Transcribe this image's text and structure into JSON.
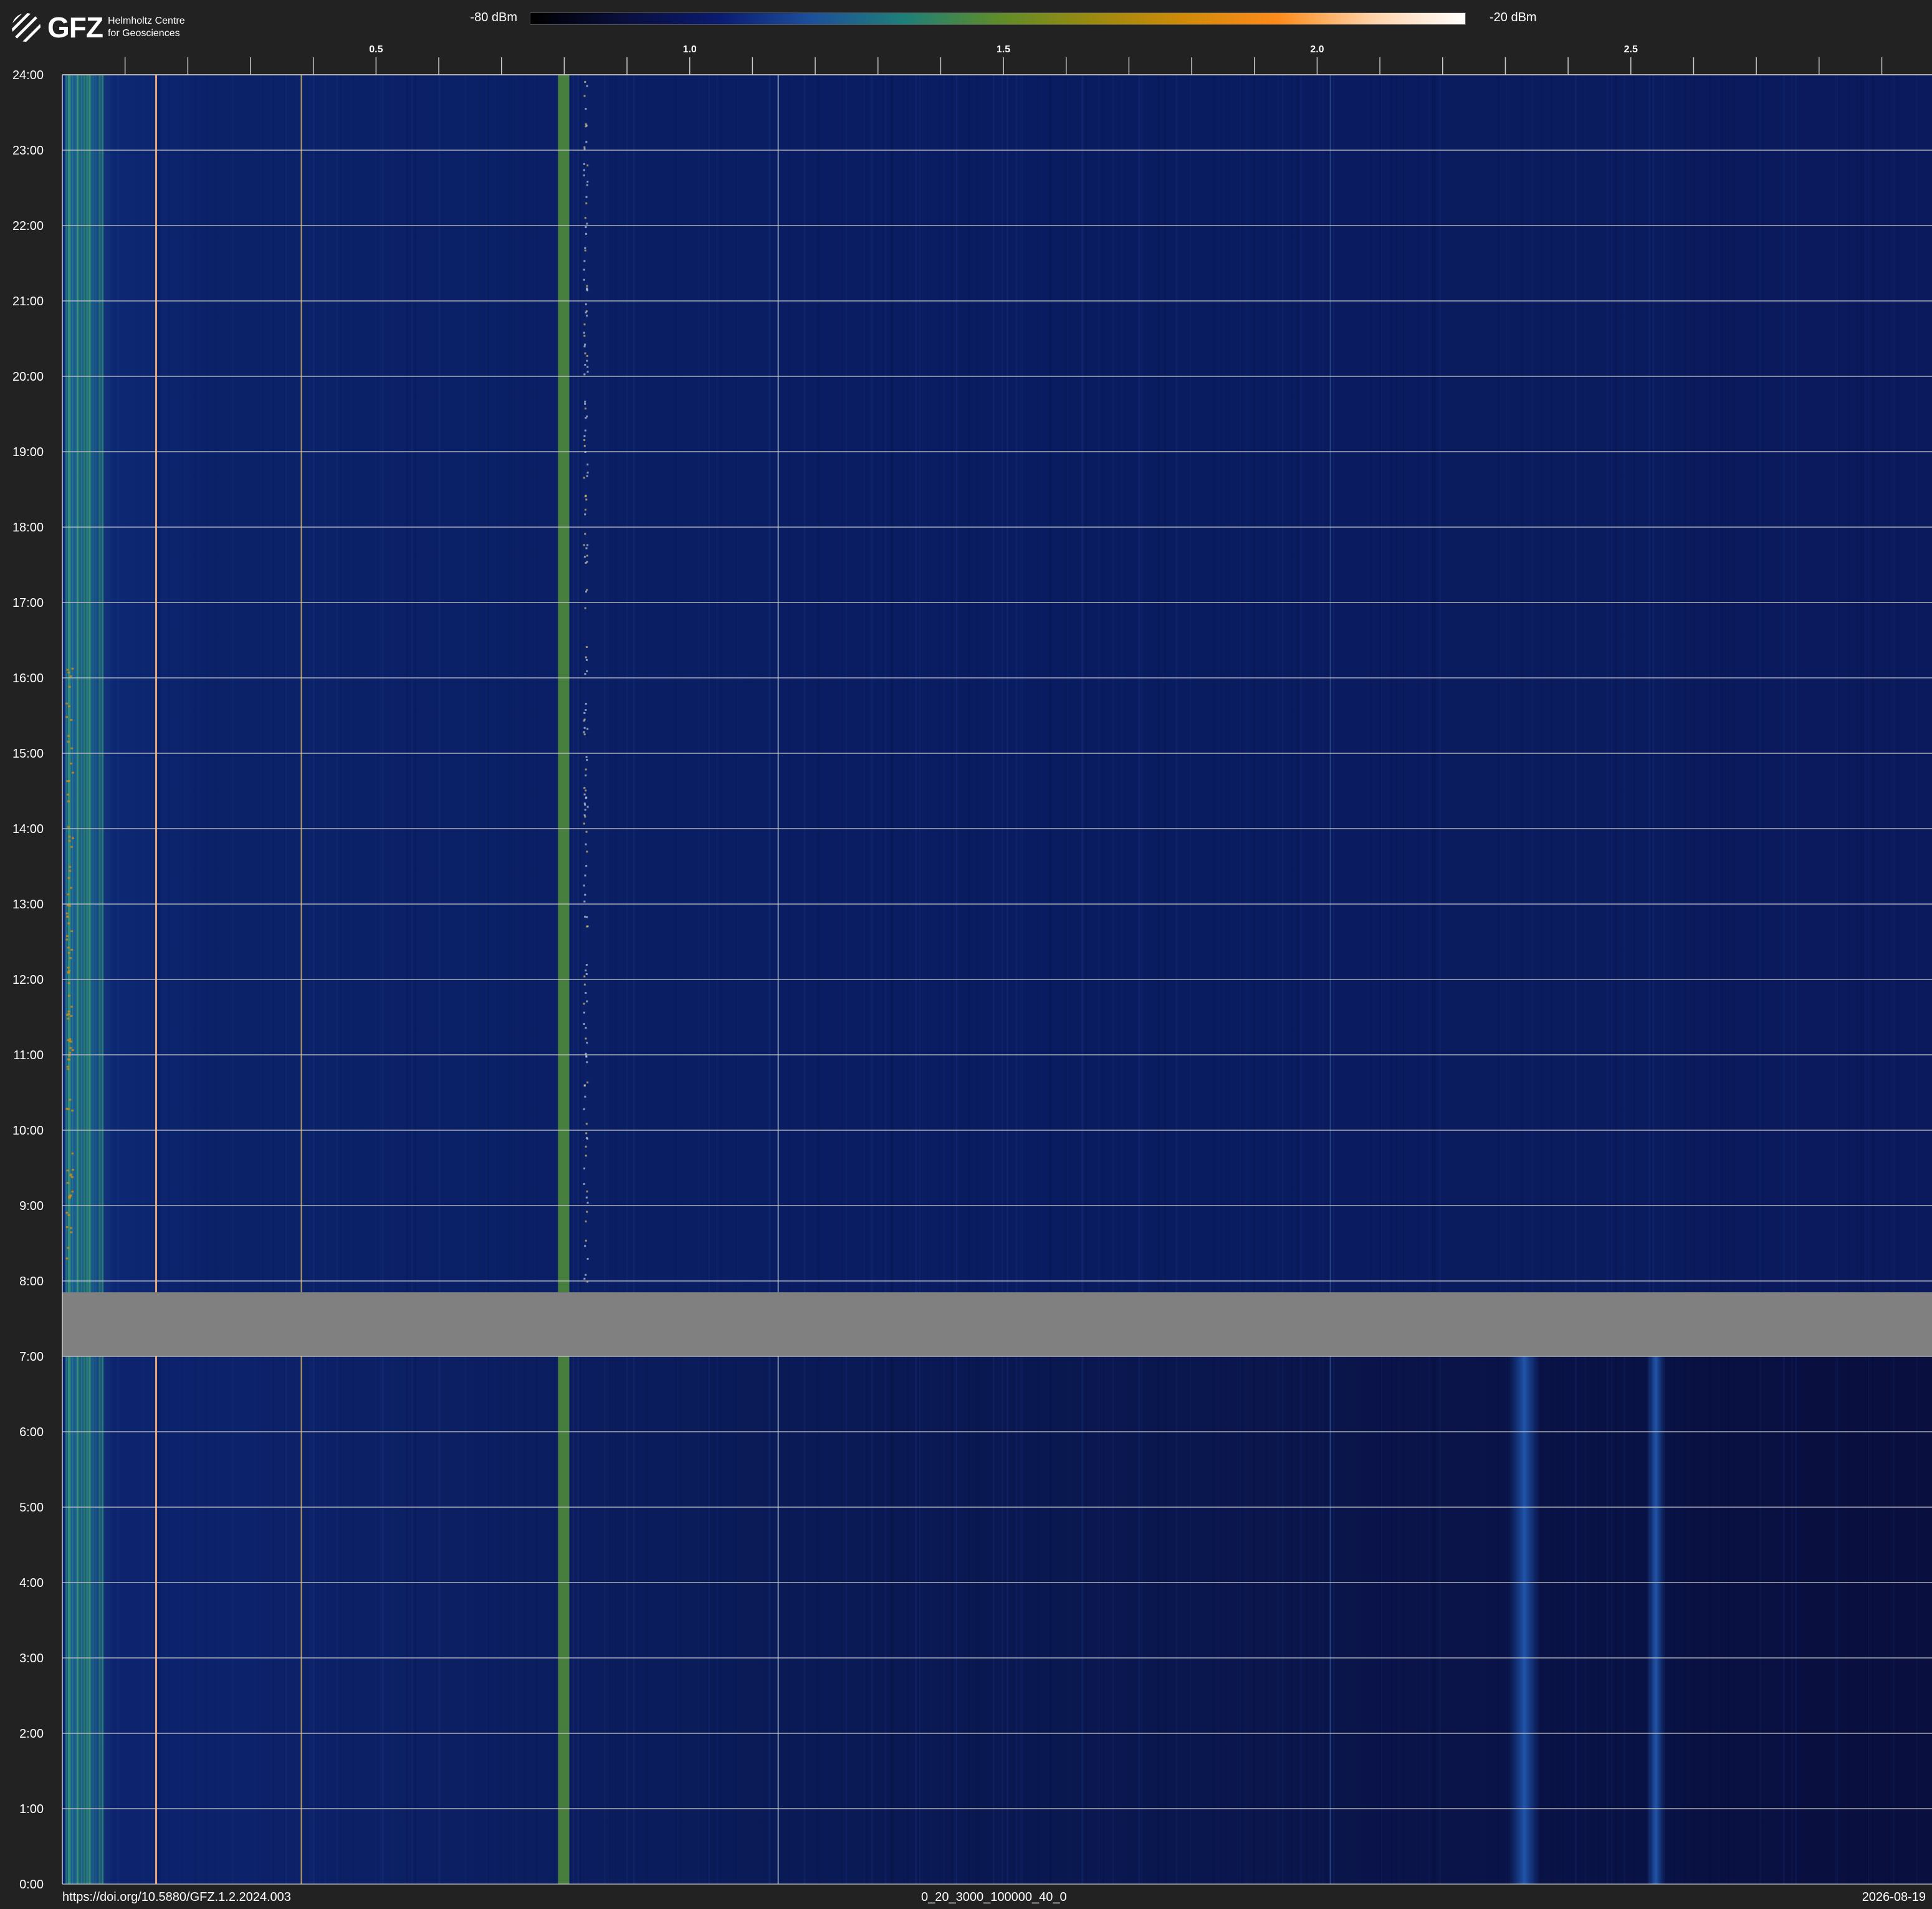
{
  "brand": {
    "logo_text": "GFZ",
    "line1": "Helmholtz Centre",
    "line2": "for Geosciences"
  },
  "colorbar": {
    "min_label": "-80 dBm",
    "max_label": "-20 dBm",
    "colors": [
      "#000000",
      "#0a0f3c",
      "#0a1a6e",
      "#1d4f9a",
      "#1e7f78",
      "#5e8c2a",
      "#9a8a10",
      "#d08a08",
      "#ff8a1a",
      "#ffd2a8",
      "#ffffff"
    ]
  },
  "chart_data": {
    "type": "heatmap",
    "title": "",
    "xlabel": "",
    "ylabel": "",
    "x_axis_position": "top",
    "x_unit_shown": "none",
    "xlim": [
      0.0,
      2.98
    ],
    "x_ticks_minor_step": 0.1,
    "x_tick_labels": [
      {
        "value": 0.5,
        "label": "0.5"
      },
      {
        "value": 1.0,
        "label": "1.0"
      },
      {
        "value": 1.5,
        "label": "1.5"
      },
      {
        "value": 2.0,
        "label": "2.0"
      },
      {
        "value": 2.5,
        "label": "2.5"
      }
    ],
    "ylim": [
      0,
      24
    ],
    "y_ticks": [
      "0:00",
      "1:00",
      "2:00",
      "3:00",
      "4:00",
      "5:00",
      "6:00",
      "7:00",
      "8:00",
      "9:00",
      "10:00",
      "11:00",
      "12:00",
      "13:00",
      "14:00",
      "15:00",
      "16:00",
      "17:00",
      "18:00",
      "19:00",
      "20:00",
      "21:00",
      "22:00",
      "23:00",
      "24:00"
    ],
    "grid": "horizontal lines at every hour",
    "background_level_dbm": -72,
    "no_data_intervals": [
      {
        "start_hour": 7.0,
        "end_hour": 7.85
      }
    ],
    "persistent_signals": [
      {
        "x": 0.005,
        "width": 0.03,
        "level_dbm": -55,
        "color": "#1f6f8c",
        "label": "broadband low-frequency noise"
      },
      {
        "x": 0.148,
        "width": 0.003,
        "level_dbm": -25,
        "color": "#ffb070"
      },
      {
        "x": 0.38,
        "width": 0.002,
        "level_dbm": -50,
        "color": "#c8a858"
      },
      {
        "x": 0.79,
        "width": 0.018,
        "level_dbm": -46,
        "color": "#4e8a3a"
      },
      {
        "x": 1.14,
        "width": 0.002,
        "level_dbm": -55,
        "color": "#8aa0b8"
      },
      {
        "x": 2.02,
        "width": 0.002,
        "level_dbm": -58,
        "color": "#2a4a8a"
      }
    ],
    "intermittent_bands": [
      {
        "x_center": 2.33,
        "width": 0.05,
        "start_hour": 0.0,
        "end_hour": 7.0,
        "level_dbm": -60,
        "color": "#1a5ab8"
      },
      {
        "x_center": 2.54,
        "width": 0.03,
        "start_hour": 0.0,
        "end_hour": 7.0,
        "level_dbm": -64,
        "color": "#1a4aa0"
      }
    ]
  },
  "footer": {
    "doi": "https://doi.org/10.5880/GFZ.1.2.2024.003",
    "code": "0_20_3000_100000_40_0",
    "date": "2026-08-19"
  }
}
